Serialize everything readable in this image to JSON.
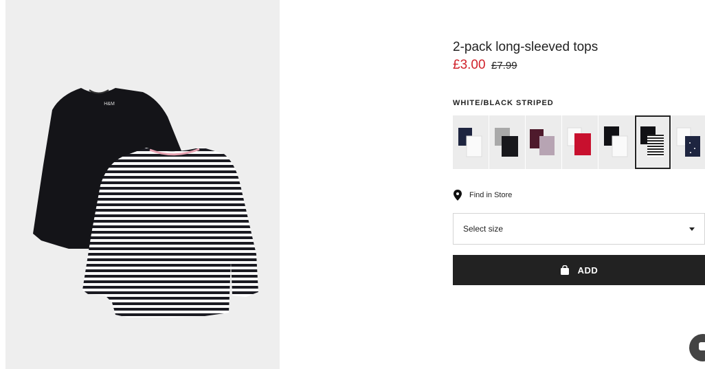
{
  "product": {
    "title": "2-pack long-sleeved tops",
    "price_current": "£3.00",
    "price_original": "£7.99",
    "color_name": "WHITE/BLACK STRIPED",
    "price_color": "#d0212a"
  },
  "swatches": [
    {
      "name": "navy-white",
      "selected": false
    },
    {
      "name": "grey-black",
      "selected": false
    },
    {
      "name": "burgundy-lilac",
      "selected": false
    },
    {
      "name": "white-red",
      "selected": false
    },
    {
      "name": "black-white",
      "selected": false
    },
    {
      "name": "black-striped",
      "selected": true
    },
    {
      "name": "white-navy-dotted",
      "selected": false
    }
  ],
  "store": {
    "icon": "location-pin-icon",
    "label": "Find in Store"
  },
  "size_select": {
    "label": "Select size",
    "icon": "caret-down-icon"
  },
  "add_button": {
    "label": "ADD",
    "icon": "shopping-bag-icon",
    "color": "#222222"
  },
  "hero_image": {
    "tag_text": "H&M"
  },
  "chat": {
    "icon": "chat-icon"
  }
}
